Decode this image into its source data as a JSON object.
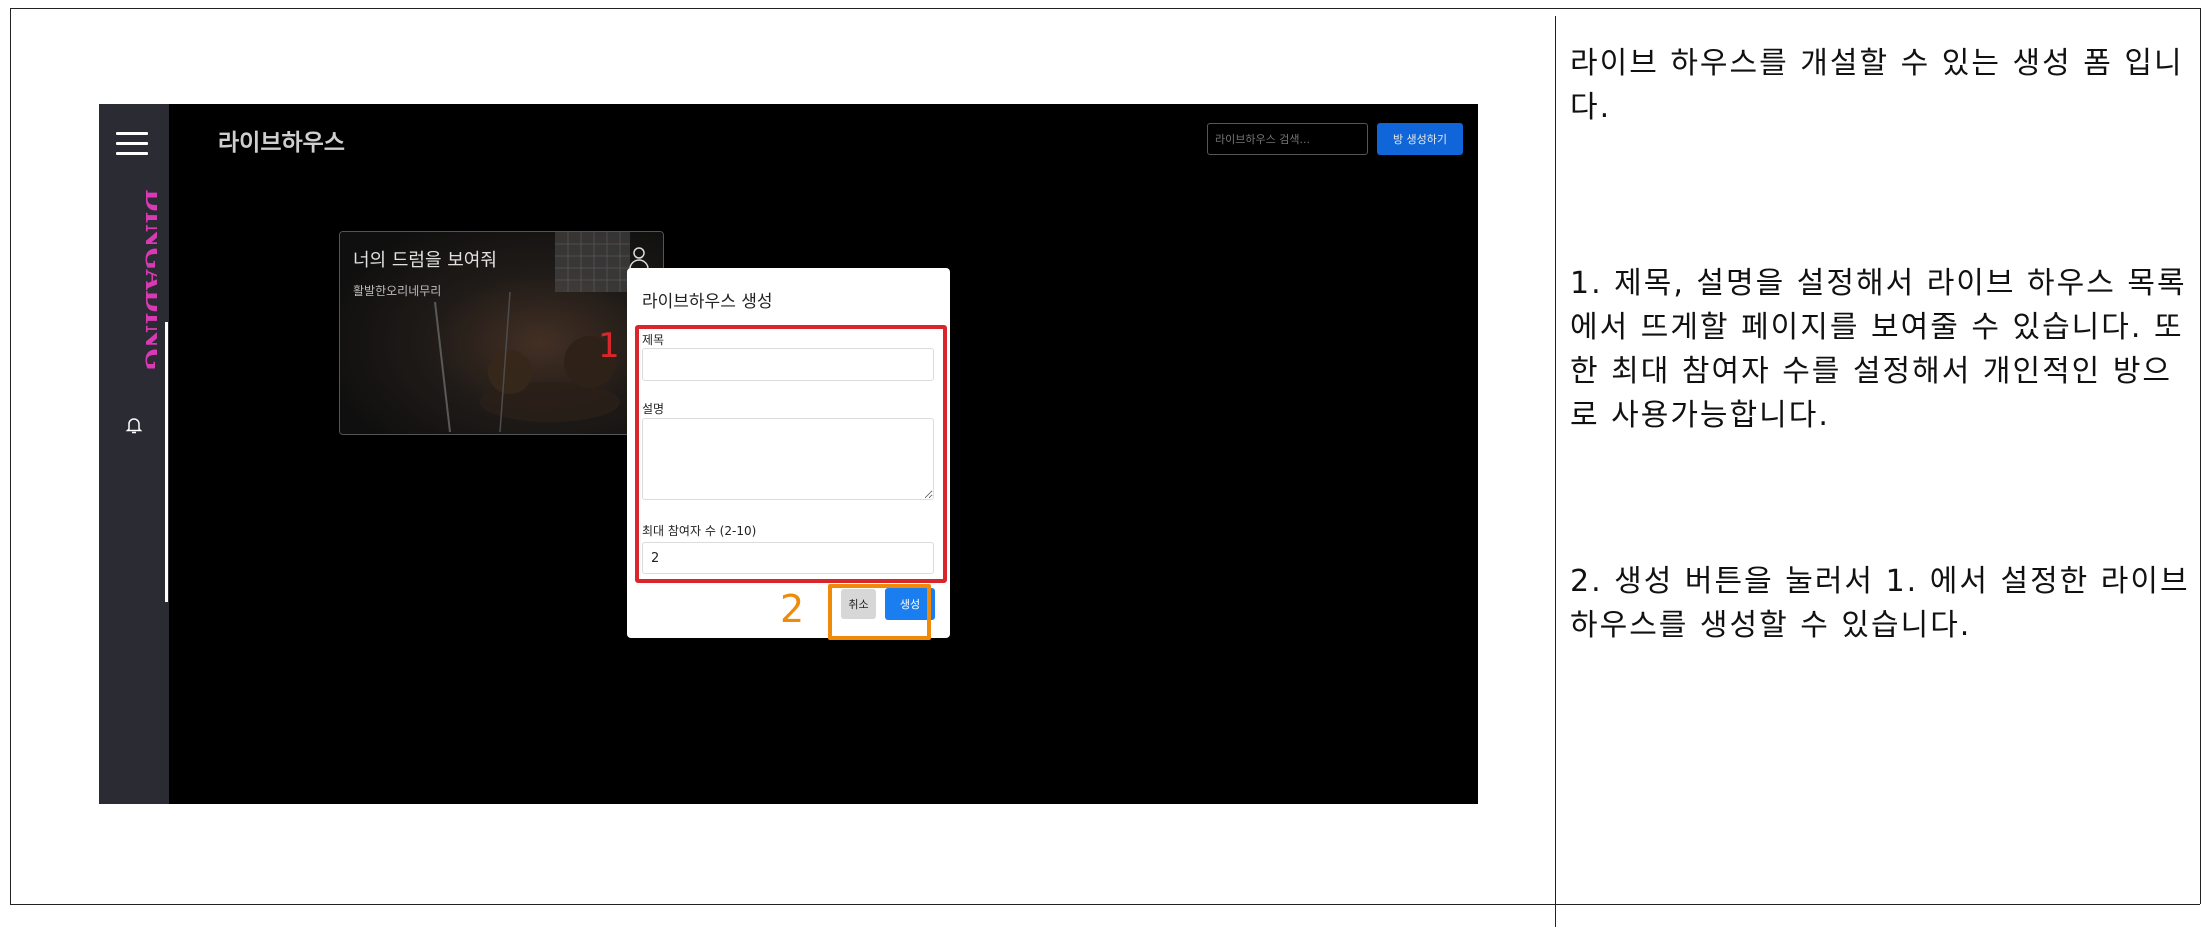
{
  "screenshot": {
    "sidebar": {
      "brand": "DINGADING",
      "brand_color": "#d93ab4"
    },
    "header": {
      "title": "라이브하우스",
      "search_placeholder": "라이브하우스 검색...",
      "create_button": "방 생성하기"
    },
    "card": {
      "title": "너의 드럼을 보여줘",
      "subtitle": "활발한오리네무리"
    },
    "modal": {
      "title": "라이브하우스 생성",
      "title_label": "제목",
      "title_value": "",
      "description_label": "설명",
      "description_value": "",
      "max_label": "최대 참여자 수 (2-10)",
      "max_value": "2",
      "cancel_button": "취소",
      "submit_button": "생성"
    }
  },
  "annotations": {
    "marker_1": "1",
    "marker_2": "2",
    "marker_1_color": "#d9262a",
    "marker_2_color": "#f08a0b"
  },
  "notes": {
    "intro": "라이브 하우스를 개설할 수 있는 생성 폼 입니다.",
    "step1": "1. 제목, 설명을 설정해서 라이브 하우스 목록에서 뜨게할 페이지를 보여줄 수 있습니다. 또한 최대 참여자 수를 설정해서 개인적인 방으로 사용가능합니다.",
    "step2": "2. 생성 버튼을 눌러서 1. 에서 설정한 라이브하우스를 생성할 수 있습니다."
  }
}
